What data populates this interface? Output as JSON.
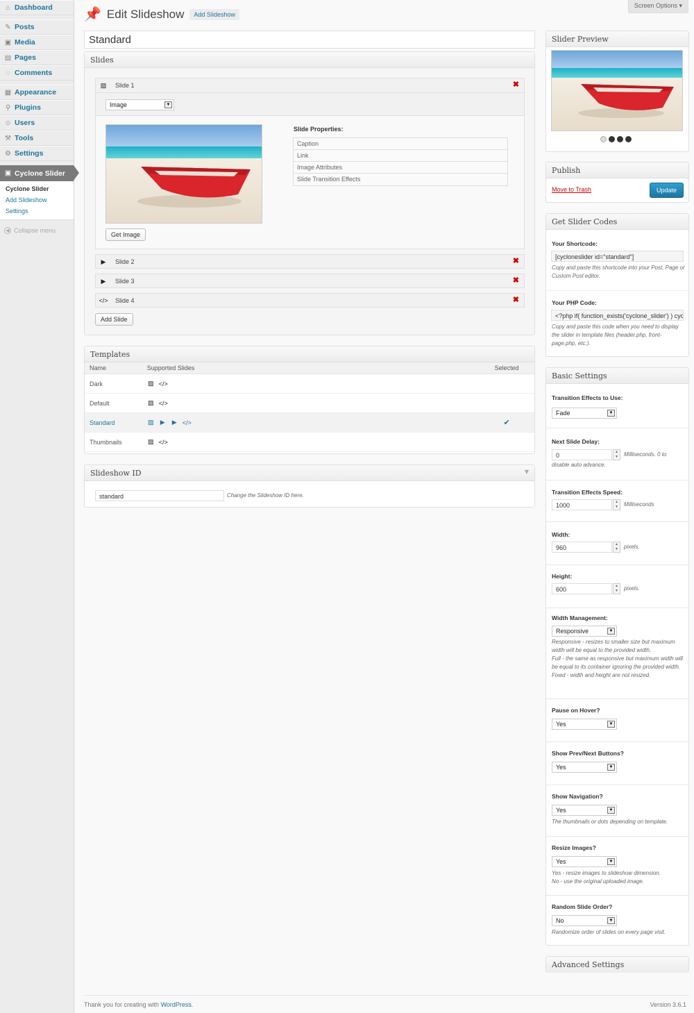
{
  "sidebar": {
    "items": [
      {
        "label": "Dashboard",
        "icon": "dashboard-icon"
      },
      {
        "label": "Posts",
        "icon": "pin-icon"
      },
      {
        "label": "Media",
        "icon": "media-icon"
      },
      {
        "label": "Pages",
        "icon": "pages-icon"
      },
      {
        "label": "Comments",
        "icon": "comments-icon"
      },
      {
        "label": "Appearance",
        "icon": "appearance-icon"
      },
      {
        "label": "Plugins",
        "icon": "plugins-icon"
      },
      {
        "label": "Users",
        "icon": "users-icon"
      },
      {
        "label": "Tools",
        "icon": "tools-icon"
      },
      {
        "label": "Settings",
        "icon": "settings-icon"
      },
      {
        "label": "Cyclone Slider",
        "icon": "cyclone-slider-icon"
      }
    ],
    "submenu": [
      "Cyclone Slider",
      "Add Slideshow",
      "Settings"
    ],
    "collapse_label": "Collapse menu"
  },
  "header": {
    "title": "Edit Slideshow",
    "add_new": "Add Slideshow",
    "screen_options": "Screen Options"
  },
  "post_title": "Standard",
  "slides_box": {
    "title": "Slides",
    "slides": [
      {
        "label": "Slide 1",
        "type": "image"
      },
      {
        "label": "Slide 2",
        "type": "youtube"
      },
      {
        "label": "Slide 3",
        "type": "video"
      },
      {
        "label": "Slide 4",
        "type": "custom"
      }
    ],
    "type_select": "Image",
    "get_image": "Get Image",
    "properties_heading": "Slide Properties:",
    "properties": [
      "Caption",
      "Link",
      "Image Attributes",
      "Slide Transition Effects"
    ],
    "add_slide": "Add Slide"
  },
  "templates": {
    "title": "Templates",
    "columns": [
      "Name",
      "Supported Slides",
      "Selected"
    ],
    "rows": [
      {
        "name": "Dark",
        "icons": [
          "image-icon",
          "code-icon"
        ],
        "selected": false
      },
      {
        "name": "Default",
        "icons": [
          "image-icon",
          "code-icon"
        ],
        "selected": false
      },
      {
        "name": "Standard",
        "icons": [
          "image-icon",
          "youtube-icon",
          "play-icon",
          "code-icon"
        ],
        "selected": true
      },
      {
        "name": "Thumbnails",
        "icons": [
          "image-icon",
          "code-icon"
        ],
        "selected": false
      }
    ]
  },
  "slideshow_id": {
    "title": "Slideshow ID",
    "value": "standard",
    "hint": "Change the Slideshow ID here."
  },
  "preview": {
    "title": "Slider Preview",
    "dots": 4,
    "active_dot": 0
  },
  "publish": {
    "title": "Publish",
    "trash": "Move to Trash",
    "update": "Update"
  },
  "codes": {
    "title": "Get Slider Codes",
    "shortcode_label": "Your Shortcode:",
    "shortcode": "[cycloneslider id=\"standard\"]",
    "shortcode_desc": "Copy and paste this shortcode into your Post, Page or Custom Post editor.",
    "php_label": "Your PHP Code:",
    "php": "<?php if( function_exists('cyclone_slider') ) cyc",
    "php_desc": "Copy and paste this code when you need to display the slider in template files (header.php, front-page.php, etc.)."
  },
  "basic": {
    "title": "Basic Settings",
    "fx_label": "Transition Effects to Use:",
    "fx_value": "Fade",
    "delay_label": "Next Slide Delay:",
    "delay_value": "0",
    "delay_unit": "Milliseconds. 0 to",
    "delay_unit2": "disable auto advance.",
    "speed_label": "Transition Effects Speed:",
    "speed_value": "1000",
    "speed_unit": "Milliseconds",
    "width_label": "Width:",
    "width_value": "960",
    "width_unit": "pixels.",
    "height_label": "Height:",
    "height_value": "600",
    "height_unit": "pixels.",
    "wm_label": "Width Management:",
    "wm_value": "Responsive",
    "wm_desc1": "Responsive - resizes to smaller size but maximum width will be equal to the provided width.",
    "wm_desc2": "Full - the same as responsive but maximum width will be equal to its container ignoring the provided width.",
    "wm_desc3": "Fixed - width and height are not resized.",
    "pause_label": "Pause on Hover?",
    "pause_value": "Yes",
    "prevnext_label": "Show Prev/Next Buttons?",
    "prevnext_value": "Yes",
    "nav_label": "Show Navigation?",
    "nav_value": "Yes",
    "nav_desc": "The thumbnails or dots depending on template.",
    "resize_label": "Resize Images?",
    "resize_value": "Yes",
    "resize_desc1": "Yes - resize images to slideshow dimension.",
    "resize_desc2": "No - use the original uploaded image.",
    "random_label": "Random Slide Order?",
    "random_value": "No",
    "random_desc": "Randomize order of slides on every page visit."
  },
  "advanced": {
    "title": "Advanced Settings"
  },
  "footer": {
    "thanks": "Thank you for creating with ",
    "wp": "WordPress",
    "period": ".",
    "version": "Version 3.6.1"
  },
  "colors": {
    "link": "#21759b",
    "delete": "#cc0000",
    "update_button": "#2a95c5"
  }
}
